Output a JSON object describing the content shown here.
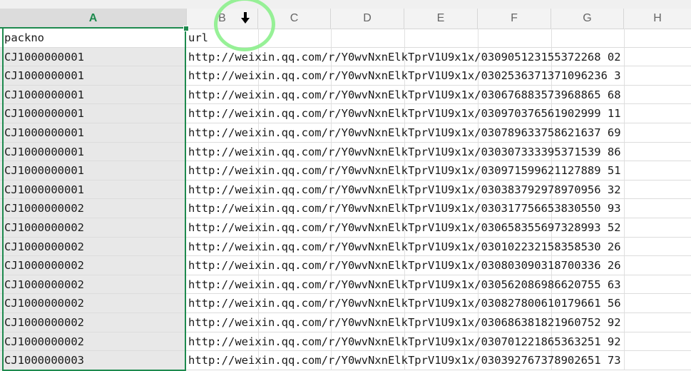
{
  "columns": [
    "A",
    "B",
    "C",
    "D",
    "E",
    "F",
    "G",
    "H"
  ],
  "header_row": {
    "a": "packno",
    "b": "url"
  },
  "rows": [
    {
      "a": "CJ1000000001",
      "b": "http://weixin.qq.com/r/Y0wvNxnElkTprV1U9x1x/030905123155372268 02"
    },
    {
      "a": "CJ1000000001",
      "b": "http://weixin.qq.com/r/Y0wvNxnElkTprV1U9x1x/0302536371371096236 3"
    },
    {
      "a": "CJ1000000001",
      "b": "http://weixin.qq.com/r/Y0wvNxnElkTprV1U9x1x/030676883573968865 68"
    },
    {
      "a": "CJ1000000001",
      "b": "http://weixin.qq.com/r/Y0wvNxnElkTprV1U9x1x/030970376561902999 11"
    },
    {
      "a": "CJ1000000001",
      "b": "http://weixin.qq.com/r/Y0wvNxnElkTprV1U9x1x/030789633758621637 69"
    },
    {
      "a": "CJ1000000001",
      "b": "http://weixin.qq.com/r/Y0wvNxnElkTprV1U9x1x/030307333395371539 86"
    },
    {
      "a": "CJ1000000001",
      "b": "http://weixin.qq.com/r/Y0wvNxnElkTprV1U9x1x/030971599621127889 51"
    },
    {
      "a": "CJ1000000001",
      "b": "http://weixin.qq.com/r/Y0wvNxnElkTprV1U9x1x/030383792978970956 32"
    },
    {
      "a": "CJ1000000002",
      "b": "http://weixin.qq.com/r/Y0wvNxnElkTprV1U9x1x/030317756653830550 93"
    },
    {
      "a": "CJ1000000002",
      "b": "http://weixin.qq.com/r/Y0wvNxnElkTprV1U9x1x/030658355697328993 52"
    },
    {
      "a": "CJ1000000002",
      "b": "http://weixin.qq.com/r/Y0wvNxnElkTprV1U9x1x/030102232158358530 26"
    },
    {
      "a": "CJ1000000002",
      "b": "http://weixin.qq.com/r/Y0wvNxnElkTprV1U9x1x/030803090318700336 26"
    },
    {
      "a": "CJ1000000002",
      "b": "http://weixin.qq.com/r/Y0wvNxnElkTprV1U9x1x/030562086986620755 63"
    },
    {
      "a": "CJ1000000002",
      "b": "http://weixin.qq.com/r/Y0wvNxnElkTprV1U9x1x/030827800610179661 56"
    },
    {
      "a": "CJ1000000002",
      "b": "http://weixin.qq.com/r/Y0wvNxnElkTprV1U9x1x/030686381821960752 92"
    },
    {
      "a": "CJ1000000002",
      "b": "http://weixin.qq.com/r/Y0wvNxnElkTprV1U9x1x/030701221865363251 92"
    },
    {
      "a": "CJ1000000003",
      "b": "http://weixin.qq.com/r/Y0wvNxnElkTprV1U9x1x/030392767378902651 73"
    }
  ],
  "colors": {
    "selection": "#1e8a4e",
    "highlight_ring": "#8cf08c"
  },
  "icons": {
    "cursor": "down-arrow-cursor-icon"
  }
}
